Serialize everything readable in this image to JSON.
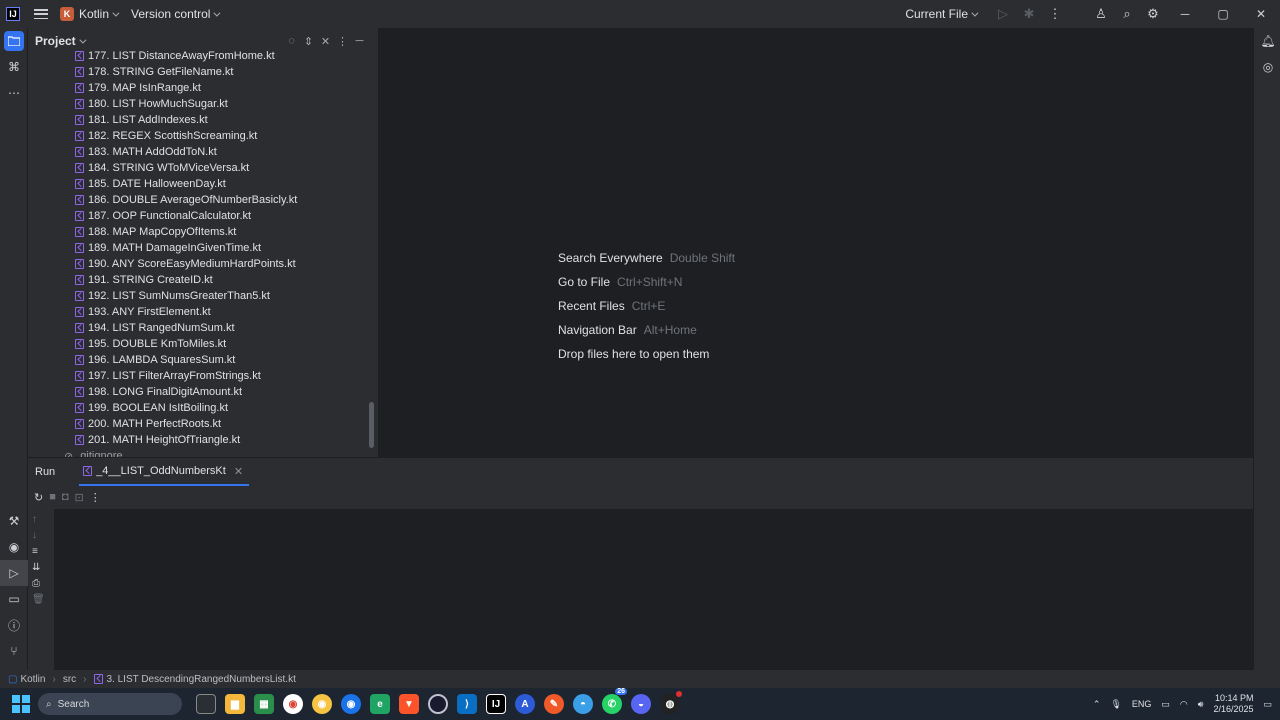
{
  "titlebar": {
    "logo_letter": "IJ",
    "project_badge": "K",
    "project_name": "Kotlin",
    "vcs": "Version control",
    "run_config": "Current File"
  },
  "project_panel": {
    "title": "Project",
    "files": [
      "177. LIST DistanceAwayFromHome.kt",
      "178. STRING GetFileName.kt",
      "179. MAP IsInRange.kt",
      "180. LIST HowMuchSugar.kt",
      "181. LIST AddIndexes.kt",
      "182. REGEX ScottishScreaming.kt",
      "183. MATH AddOddToN.kt",
      "184. STRING WToMViceVersa.kt",
      "185. DATE HalloweenDay.kt",
      "186. DOUBLE AverageOfNumberBasicly.kt",
      "187. OOP FunctionalCalculator.kt",
      "188. MAP MapCopyOfItems.kt",
      "189. MATH DamageInGivenTime.kt",
      "190. ANY ScoreEasyMediumHardPoints.kt",
      "191. STRING CreateID.kt",
      "192. LIST SumNumsGreaterThan5.kt",
      "193. ANY FirstElement.kt",
      "194. LIST RangedNumSum.kt",
      "195. DOUBLE KmToMiles.kt",
      "196. LAMBDA SquaresSum.kt",
      "197. LIST FilterArrayFromStrings.kt",
      "198. LONG FinalDigitAmount.kt",
      "199. BOOLEAN IsItBoiling.kt",
      "200. MATH PerfectRoots.kt",
      "201. MATH HeightOfTriangle.kt"
    ],
    "gitignore": ".gitignore"
  },
  "editor": {
    "hints": [
      {
        "label": "Search Everywhere",
        "key": "Double Shift"
      },
      {
        "label": "Go to File",
        "key": "Ctrl+Shift+N"
      },
      {
        "label": "Recent Files",
        "key": "Ctrl+E"
      },
      {
        "label": "Navigation Bar",
        "key": "Alt+Home"
      },
      {
        "label": "Drop files here to open them",
        "key": ""
      }
    ]
  },
  "run_panel": {
    "label": "Run",
    "tab": "_4__LIST_OddNumbersKt"
  },
  "statusbar": {
    "project": "Kotlin",
    "folder": "src",
    "file": "3. LIST DescendingRangedNumbersList.kt"
  },
  "taskbar": {
    "search_placeholder": "Search",
    "whatsapp_badge": "26",
    "language": "ENG",
    "time": "10:14 PM",
    "date": "2/16/2025"
  },
  "colors": {
    "accent": "#3574f0",
    "panel": "#2b2d30",
    "editor_bg": "#1e1f22",
    "kotlin_file": "#8f66e8"
  }
}
